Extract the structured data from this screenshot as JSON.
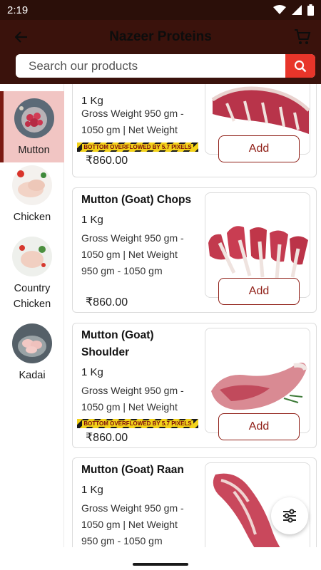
{
  "status_bar": {
    "time": "2:19"
  },
  "app_bar": {
    "title": "Nazeer Proteins"
  },
  "search": {
    "placeholder": "Search our products"
  },
  "categories": [
    {
      "label": "Mutton",
      "active": true
    },
    {
      "label": "Chicken",
      "active": false
    },
    {
      "label": "Country\nChicken",
      "active": false
    },
    {
      "label": "Kadai",
      "active": false
    }
  ],
  "products": [
    {
      "name": "",
      "qty": "1 Kg",
      "desc": "Gross Weight 950 gm - 1050 gm | Net Weight",
      "price": "₹860.00",
      "overflow": "BOTTOM OVERFLOWED BY 5.7 PIXELS",
      "add_label": "Add"
    },
    {
      "name": "Mutton (Goat) Chops",
      "qty": "1 Kg",
      "desc": "Gross Weight 950 gm - 1050 gm | Net Weight 950 gm - 1050 gm",
      "price": "₹860.00",
      "add_label": "Add"
    },
    {
      "name": "Mutton (Goat) Shoulder",
      "qty": "1 Kg",
      "desc": "Gross Weight 950 gm - 1050 gm | Net Weight",
      "price": "₹860.00",
      "overflow": "BOTTOM OVERFLOWED BY 5.7 PIXELS",
      "add_label": "Add"
    },
    {
      "name": "Mutton (Goat) Raan",
      "qty": "1 Kg",
      "desc": "Gross Weight 950 gm - 1050 gm | Net Weight 950 gm - 1050 gm",
      "price": "",
      "add_label": ""
    }
  ],
  "icons": {
    "back": "arrow-back-icon",
    "cart": "cart-icon",
    "search": "search-icon",
    "filter": "filter-sliders-icon"
  },
  "colors": {
    "app_bar": "#3a120c",
    "status_bar": "#2b0f09",
    "search_button": "#e8352a",
    "accent": "#8f1e16",
    "active_category_bg": "#f1c5c3"
  }
}
